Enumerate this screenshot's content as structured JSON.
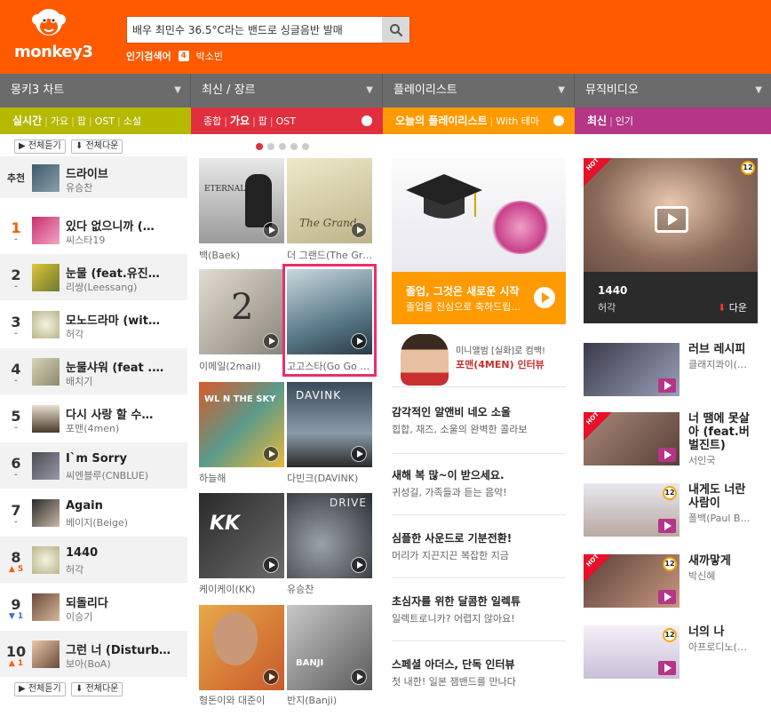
{
  "header": {
    "logo_text": "monkey3",
    "search_value": "배우 최민수 36.5°C라는 밴드로 싱글음반 발매",
    "popular_label": "인기검색어",
    "popular_rank": "4",
    "popular_term": "박소빈"
  },
  "categories": [
    {
      "label": "몽키3 차트"
    },
    {
      "label": "최신 / 장르"
    },
    {
      "label": "플레이리스트"
    },
    {
      "label": "뮤직비디오"
    }
  ],
  "subtabs": {
    "chart": {
      "active": "실시간",
      "items": [
        "가요",
        "팝",
        "OST",
        "소설"
      ]
    },
    "genre": {
      "items": [
        "종합"
      ],
      "active": "가요",
      "items2": [
        "팝",
        "OST"
      ]
    },
    "playlist": {
      "active": "오늘의 플레이리스트",
      "other": "With 테마"
    },
    "mv": {
      "active": "최신",
      "other": "인기"
    }
  },
  "buttons": {
    "play_all": "전체듣기",
    "download_all": "전체다운"
  },
  "chart": [
    {
      "rank": "추천",
      "title": "드라이브",
      "artist": "유승찬",
      "delta": ""
    },
    {
      "rank": "1",
      "title": "있다 없으니까 (…",
      "artist": "씨스타19",
      "delta": "-"
    },
    {
      "rank": "2",
      "title": "눈물 (feat.유진…",
      "artist": "리쌍(Leessang)",
      "delta": "-"
    },
    {
      "rank": "3",
      "title": "모노드라마 (wit…",
      "artist": "허각",
      "delta": "-"
    },
    {
      "rank": "4",
      "title": "눈물샤워 (feat .…",
      "artist": "배치기",
      "delta": "-"
    },
    {
      "rank": "5",
      "title": "다시 사랑 할 수…",
      "artist": "포맨(4men)",
      "delta": "-"
    },
    {
      "rank": "6",
      "title": "I`m Sorry",
      "artist": "씨엔블루(CNBLUE)",
      "delta": "-"
    },
    {
      "rank": "7",
      "title": "Again",
      "artist": "베이지(Beige)",
      "delta": "-"
    },
    {
      "rank": "8",
      "title": "1440",
      "artist": "허각",
      "delta": "▲ 5"
    },
    {
      "rank": "9",
      "title": "되돌리다",
      "artist": "이승기",
      "delta": "▼ 1"
    },
    {
      "rank": "10",
      "title": "그런 너 (Disturb…",
      "artist": "보아(BoA)",
      "delta": "▲ 1"
    }
  ],
  "albums": [
    {
      "label": "백(Baek)"
    },
    {
      "label": "더 그랜드(The Gr…"
    },
    {
      "label": "이메일(2mail)"
    },
    {
      "label": "고고스타(Go Go …"
    },
    {
      "label": "하늘해"
    },
    {
      "label": "다빈크(DAVINK)"
    },
    {
      "label": "케이케이(KK)"
    },
    {
      "label": "유승찬"
    },
    {
      "label": "형돈이와 대준이"
    },
    {
      "label": "반지(Banji)"
    }
  ],
  "album_art_text": {
    "a1": "ETERNAL",
    "a2": "The Grand",
    "a6": "DAVINK",
    "a7": "KK",
    "a8": "DRIVE",
    "a10": "BANJI"
  },
  "playlist": {
    "hero_title": "졸업, 그것은 새로운 시작",
    "hero_sub": "졸업을 진심으로 축하드립…",
    "promo_small": "미니앨범 [실화]로 컴백!",
    "promo_title": "포맨(4MEN) 인터뷰",
    "items": [
      {
        "title": "감각적인 알앤비 네오 소울",
        "sub": "힙합, 재즈, 소울의 완벽한 콜라보"
      },
      {
        "title": "새해 복 많~이 받으세요.",
        "sub": "귀성길, 가족들과 듣는 음악!"
      },
      {
        "title": "심플한 사운드로 기분전환!",
        "sub": "머리가 지끈지끈 복잡한 지금"
      },
      {
        "title": "초심자를 위한 달콤한 일렉튜",
        "sub": "일렉트로니카? 어렵지 않아요!"
      },
      {
        "title": "스페셜 아더스, 단독 인터뷰",
        "sub": "첫 내한! 일본 잼밴드를 만나다"
      }
    ]
  },
  "mv": {
    "hero_title": "1440",
    "hero_artist": "허각",
    "hero_download": "다운",
    "hot": "HOT",
    "age": "12",
    "items": [
      {
        "title": "러브 레시피",
        "artist": "클래지콰이(…"
      },
      {
        "title": "너 땜에 못살아 (feat.버벌진트)",
        "artist": "서인국"
      },
      {
        "title": "내게도 너란 사람이",
        "artist": "폴백(Paul B…"
      },
      {
        "title": "새까맣게",
        "artist": "박신혜"
      },
      {
        "title": "너의 나",
        "artist": "아프로디노(…"
      }
    ]
  },
  "colors": {
    "brand": "#ff5a00",
    "chart_tab": "#b5b902",
    "genre_tab": "#e03040",
    "playlist_tab": "#ff9a00",
    "mv_tab": "#b53586"
  }
}
